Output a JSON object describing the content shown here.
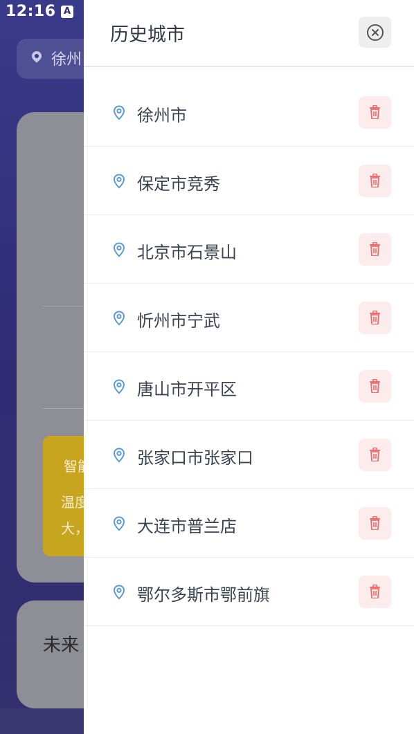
{
  "status_bar": {
    "time": "12:16",
    "indicator": "A"
  },
  "background": {
    "location_text": "徐州",
    "alert_title": "智能",
    "alert_line1": "温度",
    "alert_line2": "大，",
    "forecast_title": "未来"
  },
  "drawer": {
    "title": "历史城市",
    "close_icon": "close-circle-icon",
    "items_icon": "location-pin-icon",
    "delete_icon": "trash-icon",
    "colors": {
      "pin": "#5b9bd5",
      "delete": "#f06b6b",
      "delete_bg": "#fdecec"
    },
    "cities": [
      {
        "name": "徐州市"
      },
      {
        "name": "保定市竞秀"
      },
      {
        "name": "北京市石景山"
      },
      {
        "name": "忻州市宁武"
      },
      {
        "name": "唐山市开平区"
      },
      {
        "name": "张家口市张家口"
      },
      {
        "name": "大连市普兰店"
      },
      {
        "name": "鄂尔多斯市鄂前旗"
      }
    ]
  }
}
